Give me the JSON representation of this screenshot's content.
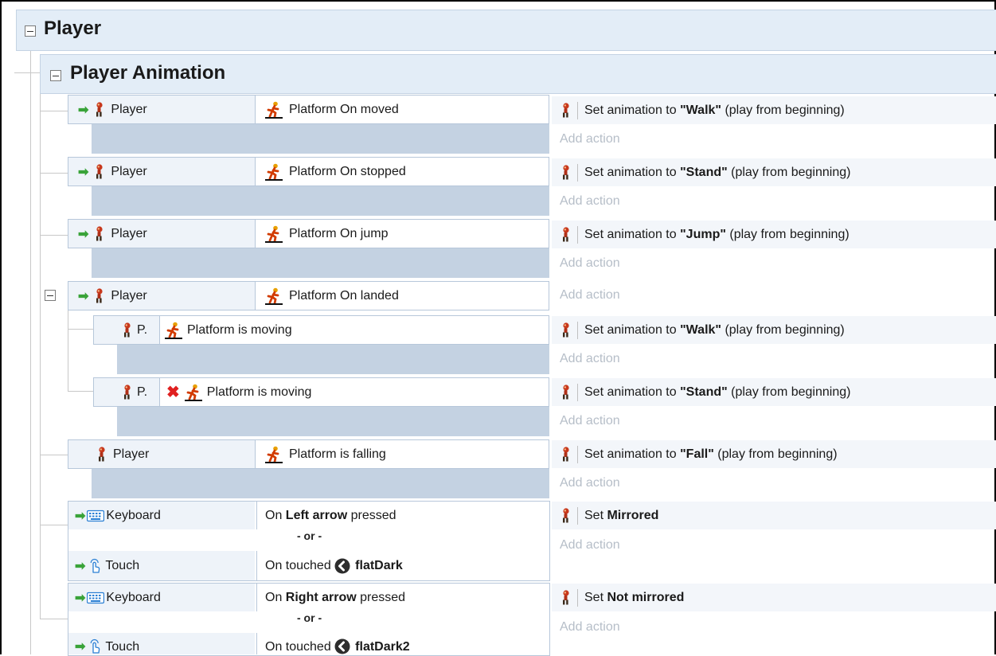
{
  "groups": {
    "player": {
      "title": "Player"
    },
    "player_animation": {
      "title": "Player Animation"
    }
  },
  "events": [
    {
      "object": "Player",
      "condition": "Platform On moved",
      "action": {
        "prefix": "Set animation to ",
        "value": "\"Walk\"",
        "suffix": " (play from beginning)"
      },
      "add_action": "Add action"
    },
    {
      "object": "Player",
      "condition": "Platform On stopped",
      "action": {
        "prefix": "Set animation to ",
        "value": "\"Stand\"",
        "suffix": " (play from beginning)"
      },
      "add_action": "Add action"
    },
    {
      "object": "Player",
      "condition": "Platform On jump",
      "action": {
        "prefix": "Set animation to ",
        "value": "\"Jump\"",
        "suffix": " (play from beginning)"
      },
      "add_action": "Add action"
    },
    {
      "object": "Player",
      "condition": "Platform On landed",
      "add_action": "Add action",
      "subevents": [
        {
          "object": "P.",
          "condition": "Platform is moving",
          "inverted": false,
          "action": {
            "prefix": "Set animation to ",
            "value": "\"Walk\"",
            "suffix": " (play from beginning)"
          },
          "add_action": "Add action"
        },
        {
          "object": "P.",
          "condition": "Platform is moving",
          "inverted": true,
          "action": {
            "prefix": "Set animation to ",
            "value": "\"Stand\"",
            "suffix": " (play from beginning)"
          },
          "add_action": "Add action"
        }
      ]
    },
    {
      "object": "Player",
      "condition": "Platform is falling",
      "action": {
        "prefix": "Set animation to ",
        "value": "\"Fall\"",
        "suffix": " (play from beginning)"
      },
      "add_action": "Add action"
    },
    {
      "conditions": [
        {
          "object": "Keyboard",
          "pre": "On ",
          "bold": "Left arrow",
          "post": " pressed"
        },
        {
          "object": "Touch",
          "pre": "On touched ",
          "bold": "flatDark",
          "post": ""
        }
      ],
      "or_label": "- or -",
      "action": {
        "prefix": "Set ",
        "value": "Mirrored",
        "suffix": ""
      },
      "add_action": "Add action"
    },
    {
      "conditions": [
        {
          "object": "Keyboard",
          "pre": "On ",
          "bold": "Right arrow",
          "post": " pressed"
        },
        {
          "object": "Touch",
          "pre": "On touched ",
          "bold": "flatDark2",
          "post": ""
        }
      ],
      "or_label": "- or -",
      "action": {
        "prefix": "Set ",
        "value": "Not mirrored",
        "suffix": ""
      },
      "add_action": "Add action"
    }
  ],
  "icons": {
    "trigger": "green-arrow-icon",
    "player": "player-sprite-icon",
    "platform": "platform-behavior-icon",
    "keyboard": "keyboard-icon",
    "touch": "touch-hand-icon",
    "invert": "red-x-icon",
    "touch_target": "flatdark-sprite-icon"
  },
  "colors": {
    "group_header": "#e3edf7",
    "object_cell": "#eef3f9",
    "filler": "#c4d2e2",
    "add_action_text": "#b6bec8",
    "trigger_arrow": "#39a339",
    "invert_x": "#e02020"
  }
}
